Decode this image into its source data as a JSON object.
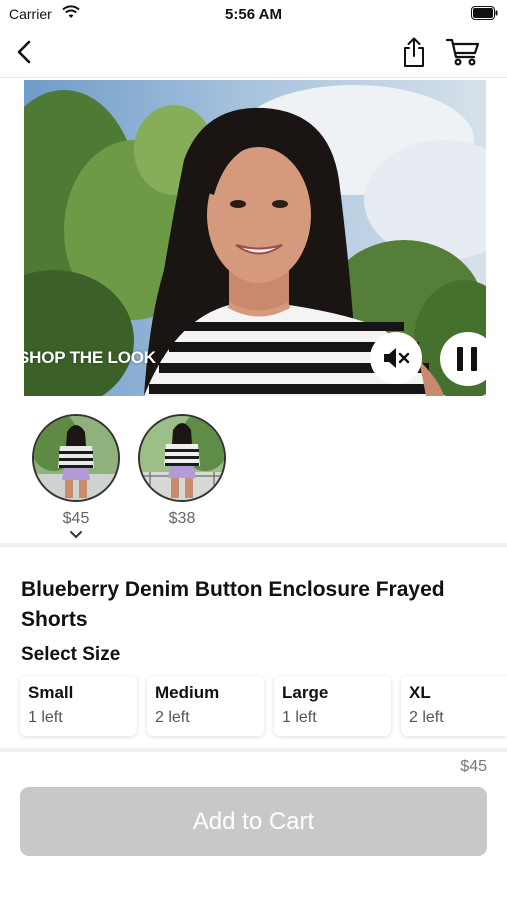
{
  "status_bar": {
    "carrier": "Carrier",
    "time": "5:56 AM"
  },
  "nav": {
    "back_icon": "chevron-left-icon",
    "share_icon": "share-icon",
    "cart_icon": "cart-icon"
  },
  "video": {
    "overlay_text": "SHOP THE LOOK",
    "mute_icon": "speaker-muted-icon",
    "pause_icon": "pause-icon"
  },
  "looks": [
    {
      "price": "$45",
      "selected": true
    },
    {
      "price": "$38",
      "selected": false
    }
  ],
  "product": {
    "title": "Blueberry Denim Button Enclosure Frayed Shorts",
    "select_size_label": "Select Size",
    "sizes": [
      {
        "name": "Small",
        "stock": "1 left"
      },
      {
        "name": "Medium",
        "stock": "2 left"
      },
      {
        "name": "Large",
        "stock": "1 left"
      },
      {
        "name": "XL",
        "stock": "2 left"
      }
    ]
  },
  "footer": {
    "price": "$45",
    "add_to_cart_label": "Add to Cart",
    "button_color": "#c8c8c8"
  }
}
